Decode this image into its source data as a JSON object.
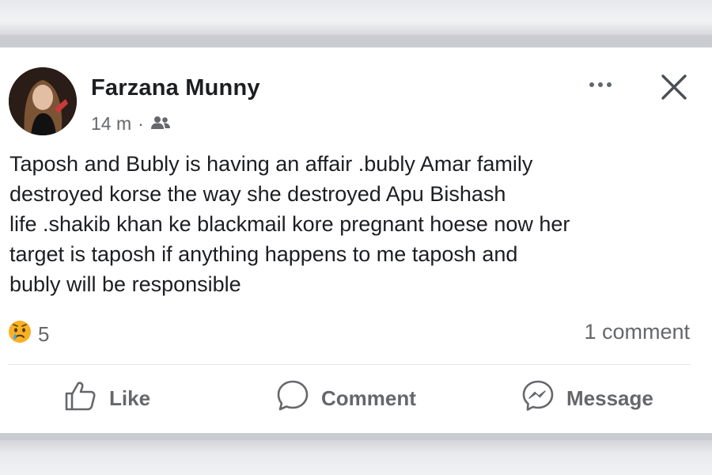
{
  "post": {
    "author": "Farzana Munny",
    "time": "14 m",
    "separator": "·",
    "audience_icon": "friends-icon",
    "text_lines": [
      "Taposh and Bubly is having an affair .bubly Amar family",
      "destroyed korse the way she destroyed Apu Bishash",
      "life .shakib khan ke blackmail kore pregnant hoese now her",
      "target is taposh if anything happens to me taposh and",
      "bubly will be responsible"
    ],
    "reaction_icon": "sad-face-icon",
    "reaction_count": "5",
    "comment_count": "1 comment"
  },
  "actions": {
    "like": "Like",
    "comment": "Comment",
    "message": "Message"
  },
  "colors": {
    "text": "#1c1e21",
    "secondary": "#65676b",
    "reaction": "#f7b125"
  }
}
